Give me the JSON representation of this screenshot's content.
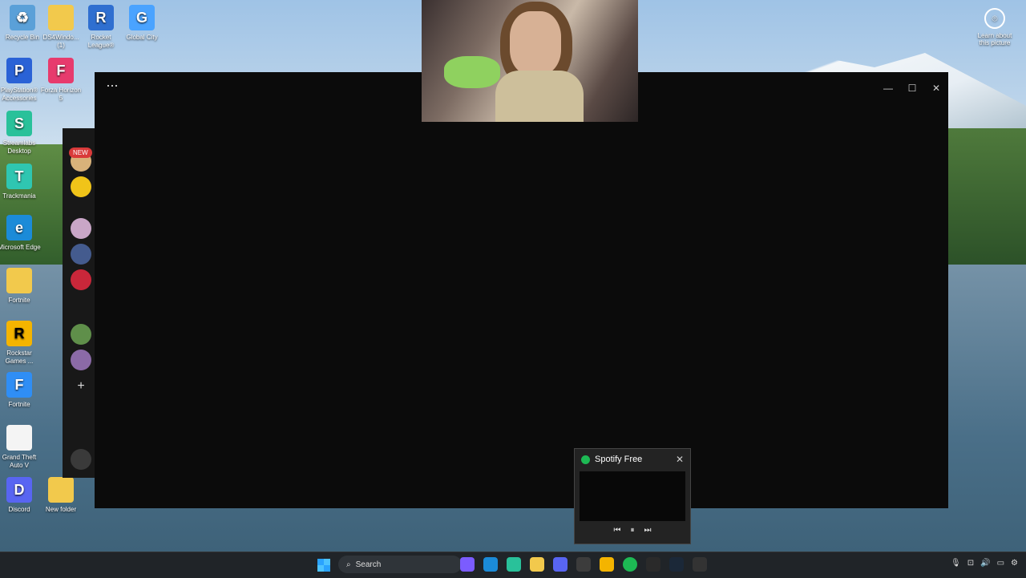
{
  "desktop": {
    "icons": [
      {
        "label": "Recycle Bin",
        "icon": "recycle-bin-icon",
        "color": "#5aa0d8",
        "glyph": "♻"
      },
      {
        "label": "DS4Windo... (1)",
        "icon": "folder-icon",
        "color": "#f2c94c",
        "glyph": ""
      },
      {
        "label": "Rocket League®",
        "icon": "rocket-league-icon",
        "color": "#2f6fd0",
        "glyph": "R"
      },
      {
        "label": "Global City",
        "icon": "global-city-icon",
        "color": "#4aa3ff",
        "glyph": "G"
      },
      {
        "label": "PlayStation® Accessories",
        "icon": "playstation-icon",
        "color": "#2a62d6",
        "glyph": "P"
      },
      {
        "label": "Forza Horizon 5",
        "icon": "forza-icon",
        "color": "#e73b6d",
        "glyph": "F"
      },
      {
        "label": "Streamlabs Desktop",
        "icon": "streamlabs-icon",
        "color": "#29c19a",
        "glyph": "S"
      },
      {
        "label": "Trackmania",
        "icon": "trackmania-icon",
        "color": "#2fc6b1",
        "glyph": "T"
      },
      {
        "label": "Microsoft Edge",
        "icon": "edge-icon",
        "color": "#1b8bd8",
        "glyph": "e"
      },
      {
        "label": "Fortnite",
        "icon": "folder-icon",
        "color": "#f2c94c",
        "glyph": ""
      },
      {
        "label": "Rockstar Games ...",
        "icon": "rockstar-icon",
        "color": "#f4b400",
        "glyph": "R"
      },
      {
        "label": "Fortnite",
        "icon": "fortnite-icon",
        "color": "#2f8ef5",
        "glyph": "F"
      },
      {
        "label": "Grand Theft Auto V",
        "icon": "file-icon",
        "color": "#f4f4f4",
        "glyph": ""
      },
      {
        "label": "Discord",
        "icon": "discord-icon",
        "color": "#5865f2",
        "glyph": "D"
      },
      {
        "label": "New folder",
        "icon": "folder-icon",
        "color": "#f2c94c",
        "glyph": ""
      }
    ],
    "learn_about": "Learn about this picture"
  },
  "window": {
    "menu": "···",
    "controls": [
      "—",
      "☐",
      "✕"
    ]
  },
  "rail": {
    "new_badge": "NEW"
  },
  "spotify": {
    "title": "Spotify Free",
    "close": "✕",
    "controls": [
      "⏮",
      "⏸",
      "⏭"
    ]
  },
  "taskbar": {
    "search": "Search"
  },
  "colors": {
    "accent": "#1db954",
    "window_bg": "#0b0b0b",
    "taskbar_bg": "#202428"
  }
}
